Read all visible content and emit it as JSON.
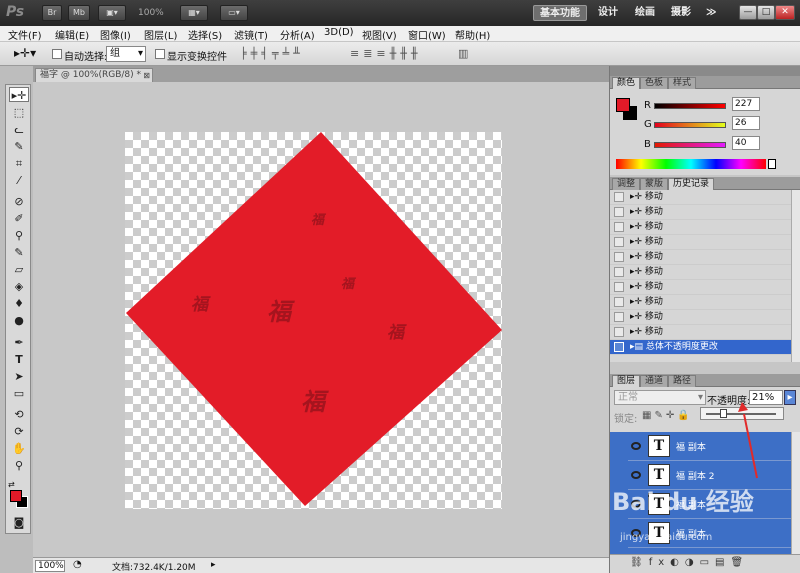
{
  "appbar": {
    "logo": "Ps",
    "btn_br": "Br",
    "btn_mb": "Mb",
    "zoom": "100%",
    "workspaces": [
      "基本功能",
      "设计",
      "绘画",
      "摄影"
    ],
    "more": "≫",
    "min": "—",
    "max": "□",
    "close": "✕"
  },
  "menu": [
    "文件(F)",
    "编辑(E)",
    "图像(I)",
    "图层(L)",
    "选择(S)",
    "滤镜(T)",
    "分析(A)",
    "3D(D)",
    "视图(V)",
    "窗口(W)",
    "帮助(H)"
  ],
  "options": {
    "auto_select_label": "自动选择:",
    "auto_select_value": "组",
    "show_transform_label": "显示变换控件"
  },
  "document": {
    "tab_title": "福字 @ 100%(RGB/8) *",
    "diamond_color": "#e31c28"
  },
  "status": {
    "zoom": "100%",
    "doc_info": "文档:732.4K/1.20M"
  },
  "color_panel": {
    "tabs": [
      "颜色",
      "色板",
      "样式"
    ],
    "r_label": "R",
    "g_label": "G",
    "b_label": "B",
    "r": "227",
    "g": "26",
    "b": "40",
    "foreground": "#e31a28",
    "background": "#000000"
  },
  "history_panel": {
    "tabs": [
      "调整",
      "蒙版",
      "历史记录"
    ],
    "items": [
      "移动",
      "移动",
      "移动",
      "移动",
      "移动",
      "移动",
      "移动",
      "移动",
      "移动",
      "移动"
    ],
    "selected": "总体不透明度更改"
  },
  "layers_panel": {
    "tabs": [
      "图层",
      "通道",
      "路径"
    ],
    "blend_mode": "正常",
    "opacity_label": "不透明度:",
    "opacity_value": "21%",
    "lock_label": "锁定:",
    "layers": [
      "福 副本",
      "福 副本 2",
      "福 副本",
      "福 副本"
    ]
  },
  "watermark": {
    "text": "Bai du 经验",
    "url": "jingyan.baidu.com"
  }
}
